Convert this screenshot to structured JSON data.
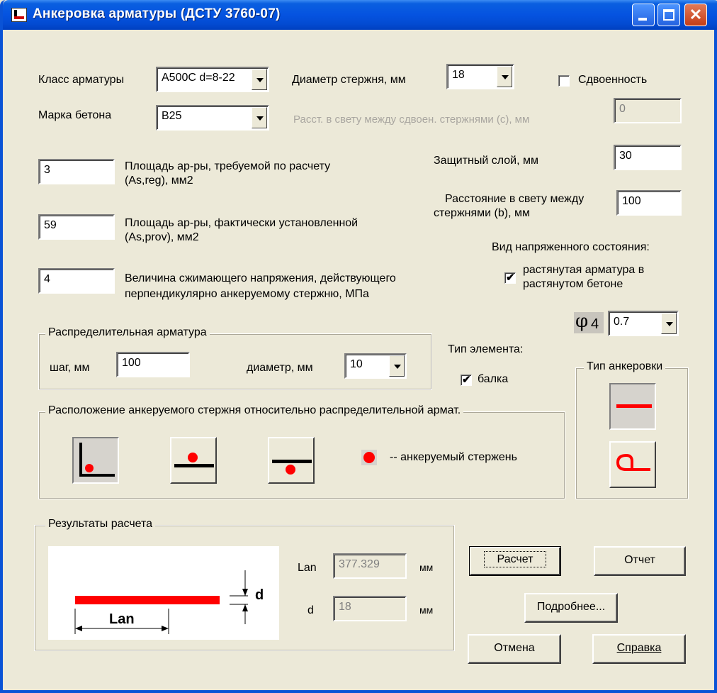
{
  "window": {
    "title": "Анкеровка арматуры  (ДСТУ 3760-07)"
  },
  "rebar_class": {
    "label": "Класс арматуры",
    "value": "A500C  d=8-22"
  },
  "diameter": {
    "label": "Диаметр  стержня, мм",
    "value": "18"
  },
  "paired": {
    "label": "Сдвоенность",
    "checked": false
  },
  "concrete": {
    "label": "Марка бетона",
    "value": "B25"
  },
  "pair_spacing": {
    "label": "Расст. в свету между сдвоен. стержнями (с), мм",
    "value": "0"
  },
  "as_req": {
    "value": "3",
    "label_line1": "Площадь ар-ры, требуемой по расчету",
    "label_line2": "(As,reg), мм2"
  },
  "as_prov": {
    "value": "59",
    "label_line1": "Площадь ар-ры, фактически установленной",
    "label_line2": "(As,prov), мм2"
  },
  "stress": {
    "value": "4",
    "label_line1": "Величина сжимающего напряжения, действующего",
    "label_line2": "перпендикулярно анкеруемому стержню, МПа"
  },
  "cover": {
    "label": "Защитный слой, мм",
    "value": "30"
  },
  "clear_spacing": {
    "label_line1": "Расстояние в свету между",
    "label_line2": "стержнями (b), мм",
    "value": "100"
  },
  "stress_state": {
    "label": "Вид напряженного состояния:",
    "option_line1": "растянутая арматура в",
    "option_line2": "растянутом бетоне",
    "checked": true
  },
  "phi4": {
    "symbol": "φ",
    "subscript": "4",
    "value": "0.7"
  },
  "distribution": {
    "legend": "Распределительная арматура",
    "step_label": "шаг, мм",
    "step_value": "100",
    "diam_label": "диаметр, мм",
    "diam_value": "10"
  },
  "element_type": {
    "label": "Тип элемента:",
    "option": "балка",
    "checked": true
  },
  "anchor_type": {
    "legend": "Тип анкеровки"
  },
  "position": {
    "legend": "Расположение анкеруемого стержня относительно распределительной армат.",
    "legend_text": "--  анкеруемый стержень"
  },
  "results": {
    "legend": "Результаты расчета",
    "lan_label": "Lan",
    "lan_value": "377.329",
    "lan_unit": "мм",
    "d_label": "d",
    "d_value": "18",
    "d_unit": "мм",
    "diagram_lan": "Lan",
    "diagram_d": "d"
  },
  "buttons": {
    "calc": "Расчет",
    "report": "Отчет",
    "more": "Подробнее...",
    "cancel": "Отмена",
    "help": "Справка"
  },
  "colors": {
    "accent_red": "#ff0000",
    "title_blue": "#0553e0"
  }
}
